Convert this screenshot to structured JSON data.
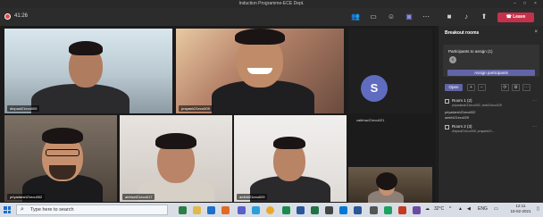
{
  "window": {
    "title": "Induction Programme-ECE Dept."
  },
  "toolbar": {
    "timer": "41:26",
    "leave_label": "Leave",
    "icons": [
      "participants-icon",
      "chat-icon",
      "reactions-icon",
      "rooms-icon",
      "more-icon",
      "camera-icon",
      "mic-icon",
      "share-icon"
    ]
  },
  "participants": {
    "tile1": "dinpaul21ecu005",
    "tile2": "prayank21ecu009",
    "tile3": "vaibhav21ecu021",
    "tile3_initial": "S",
    "tile4": "priyadarsh21ecu002",
    "tile5": "abhiset21ecu017",
    "tile6": "ambhi21ecu029"
  },
  "breakout": {
    "title": "Breakout rooms",
    "assign_label": "Participants to assign (1)",
    "assign_avatar": "S",
    "assign_button": "Assign participants",
    "open_button": "Open",
    "rooms": [
      {
        "name": "Room 1 (2)",
        "members": "priyadarsh21ecu002, amb21ecu029"
      },
      {
        "name": "Room 2 (3)",
        "members": "dinpaul21ecu005, prayank21..."
      }
    ],
    "member_lines": [
      "priyadarsh21ecu002",
      "ambhi21ecu029"
    ]
  },
  "taskbar": {
    "search_placeholder": "Type here to search",
    "temperature": "32°C",
    "language": "ENG",
    "time": "12:11",
    "date": "15-02-2021"
  },
  "colors": {
    "accent": "#6264a7",
    "leave": "#c4314b",
    "avatar": "#5f6cbf"
  }
}
